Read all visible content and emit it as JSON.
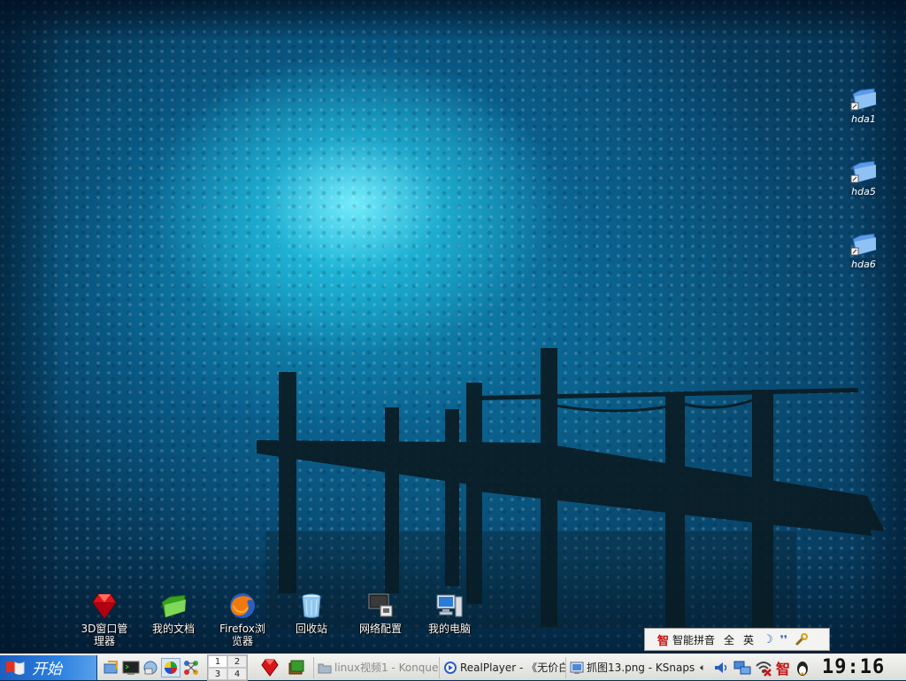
{
  "desktop": {
    "icons": [
      {
        "name": "3D窗口管\n理器",
        "icon": "ruby-gem-icon"
      },
      {
        "name": "我的文档",
        "icon": "green-folder-icon"
      },
      {
        "name": "Firefox浏\n览器",
        "icon": "firefox-icon"
      },
      {
        "name": "回收站",
        "icon": "trash-bin-icon"
      },
      {
        "name": "网络配置",
        "icon": "network-monitor-icon"
      },
      {
        "name": "我的电脑",
        "icon": "computer-icon"
      }
    ],
    "drives": [
      "hda1",
      "hda5",
      "hda6"
    ]
  },
  "ime": {
    "logo": "智",
    "name": "智能拼音",
    "full_width": "全",
    "english": "英"
  },
  "taskbar": {
    "start_label": "开始",
    "pager": [
      "1",
      "2",
      "3",
      "4"
    ],
    "tasks": [
      {
        "label": "linux视频1 - Konque",
        "state": "inactive"
      },
      {
        "label": "RealPlayer - 《无价白",
        "state": "normal"
      },
      {
        "label": "抓图13.png - KSnaps",
        "state": "normal"
      }
    ],
    "tray_ime": "智",
    "clock": "19:16"
  },
  "colors": {
    "start_blue": "#2a80e0",
    "taskbar": "#e6e6e3",
    "ime_red": "#c81010"
  }
}
